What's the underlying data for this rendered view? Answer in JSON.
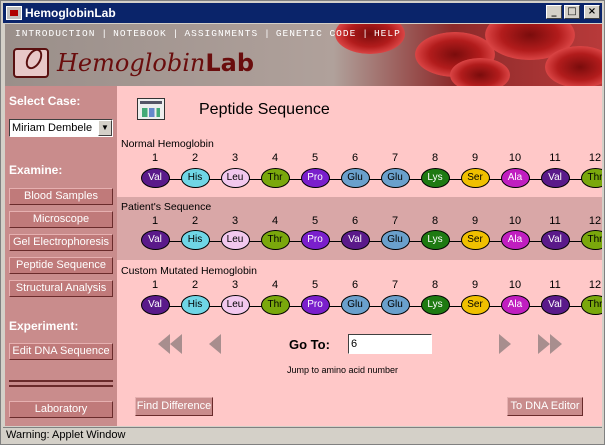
{
  "window": {
    "title": "HemoglobinLab",
    "minimize": "_",
    "maximize": "□",
    "close": "×"
  },
  "menu": [
    {
      "label": "INTRODUCTION"
    },
    {
      "label": "NOTEBOOK"
    },
    {
      "label": "ASSIGNMENTS"
    },
    {
      "label": "GENETIC CODE"
    },
    {
      "label": "HELP"
    }
  ],
  "logo": {
    "part1": "Hemoglobin",
    "part2": "Lab"
  },
  "sidebar": {
    "select_case_label": "Select Case:",
    "case_value": "Miriam Dembele",
    "examine_label": "Examine:",
    "examine_buttons": [
      "Blood Samples",
      "Microscope",
      "Gel Electrophoresis",
      "Peptide Sequence",
      "Structural Analysis"
    ],
    "experiment_label": "Experiment:",
    "edit_dna_button": "Edit DNA Sequence",
    "laboratory_button": "Laboratory"
  },
  "main": {
    "title": "Peptide Sequence",
    "positions": [
      "1",
      "2",
      "3",
      "4",
      "5",
      "6",
      "7",
      "8",
      "9",
      "10",
      "11",
      "12"
    ],
    "sequences": [
      {
        "label": "Normal Hemoglobin",
        "residues": [
          "Val",
          "His",
          "Leu",
          "Thr",
          "Pro",
          "Glu",
          "Glu",
          "Lys",
          "Ser",
          "Ala",
          "Val",
          "Thr"
        ]
      },
      {
        "label": "Patient's Sequence",
        "residues": [
          "Val",
          "His",
          "Leu",
          "Thr",
          "Pro",
          "Val",
          "Glu",
          "Lys",
          "Ser",
          "Ala",
          "Val",
          "Thr"
        ]
      },
      {
        "label": "Custom Mutated Hemoglobin",
        "residues": [
          "Val",
          "His",
          "Leu",
          "Thr",
          "Pro",
          "Glu",
          "Glu",
          "Lys",
          "Ser",
          "Ala",
          "Val",
          "Thr"
        ]
      }
    ],
    "residue_colors": {
      "Val": {
        "bg": "#5a1a8a",
        "fg": "#ffffff"
      },
      "His": {
        "bg": "#6fd6e6",
        "fg": "#000000"
      },
      "Leu": {
        "bg": "#f2c8ee",
        "fg": "#000000"
      },
      "Thr": {
        "bg": "#7aa80c",
        "fg": "#000000"
      },
      "Pro": {
        "bg": "#7a1fcc",
        "fg": "#ffffff"
      },
      "Glu": {
        "bg": "#6aa0cc",
        "fg": "#000000"
      },
      "Lys": {
        "bg": "#1e7a12",
        "fg": "#ffffff"
      },
      "Ser": {
        "bg": "#f0c000",
        "fg": "#000000"
      },
      "Ala": {
        "bg": "#c01ec0",
        "fg": "#ffffff"
      }
    },
    "goto_label": "Go To:",
    "goto_value": "6",
    "goto_hint": "Jump to amino acid number",
    "find_difference_button": "Find Difference",
    "to_dna_editor_button": "To DNA Editor"
  },
  "statusbar": {
    "text": "Warning: Applet Window"
  }
}
